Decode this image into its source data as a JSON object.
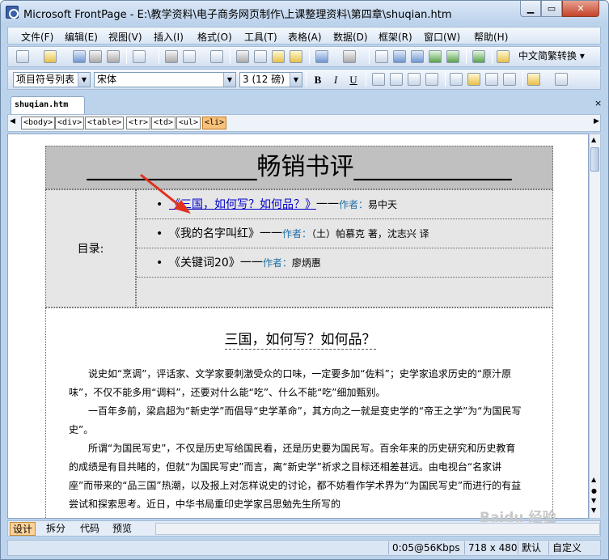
{
  "window": {
    "title": "Microsoft FrontPage - E:\\教学资料\\电子商务网页制作\\上课整理资料\\第四章\\shuqian.htm",
    "min_label": "▁",
    "max_label": "▭",
    "close_label": "✕"
  },
  "menu": [
    "文件(F)",
    "编辑(E)",
    "视图(V)",
    "插入(I)",
    "格式(O)",
    "工具(T)",
    "表格(A)",
    "数据(D)",
    "框架(R)",
    "窗口(W)",
    "帮助(H)"
  ],
  "toolbar": {
    "convert_label": "中文简繁转换"
  },
  "format_bar": {
    "style": "项目符号列表",
    "font": "宋体",
    "size": "3 (12 磅)",
    "bold": "B",
    "italic": "I",
    "underline": "U"
  },
  "doc_tab": {
    "label": "shuqian.htm",
    "close": "×"
  },
  "tags": [
    "<body>",
    "<div>",
    "<table>",
    "<tr>",
    "<td>",
    "<ul>",
    "<li>"
  ],
  "page": {
    "header_title": "______________畅销书评_____________",
    "toc_label": "目录:",
    "toc": [
      {
        "title": "《三国，如何写？如何品？》",
        "sep": "一一",
        "author_label": "作者：",
        "author": "易中天",
        "link": true
      },
      {
        "title": "《我的名字叫红》",
        "sep": "一一",
        "author_label": "作者：",
        "author": "（土）帕慕克 著，沈志兴 译",
        "link": false
      },
      {
        "title": "《关键词20》",
        "sep": "一一",
        "author_label": "作者：",
        "author": "廖炳惠",
        "link": false
      }
    ],
    "article_title": "三国，如何写？如何品？",
    "paragraphs": [
      "说史如“烹调”，评话家、文学家要刺激受众的口味，一定要多加“佐料”；史学家追求历史的“原汁原味”，不仅不能多用“调料”，还要对什么能“吃”、什么不能“吃”细加甄别。",
      "一百年多前，梁启超为“新史学”而倡导“史学革命”，其方向之一就是变史学的“帝王之学”为“为国民写史”。",
      "所谓“为国民写史”，不仅是历史写给国民看，还是历史要为国民写。百余年来的历史研究和历史教育的成绩是有目共睹的，但就“为国民写史”而言，离“新史学”祈求之目标还相差甚远。由电视台“名家讲座”而带来的“品三国”热潮，以及报上对怎样说史的讨论，都不妨看作学术界为“为国民写史”而进行的有益尝试和探索思考。近日，中华书局重印史学家吕思勉先生所写的"
    ]
  },
  "view_tabs": [
    "设计",
    "拆分",
    "代码",
    "预览"
  ],
  "status": {
    "speed": "0:05@56Kbps",
    "size": "718 x 480",
    "mode1": "默认",
    "mode2": "自定义"
  },
  "watermark": "Baidu 经验",
  "colors": {
    "link": "#0000cc",
    "author_label": "#1f6fa8",
    "header_bg": "#c0c0c0",
    "toc_bg": "#e6e6e6",
    "arrow": "#e0321e"
  }
}
